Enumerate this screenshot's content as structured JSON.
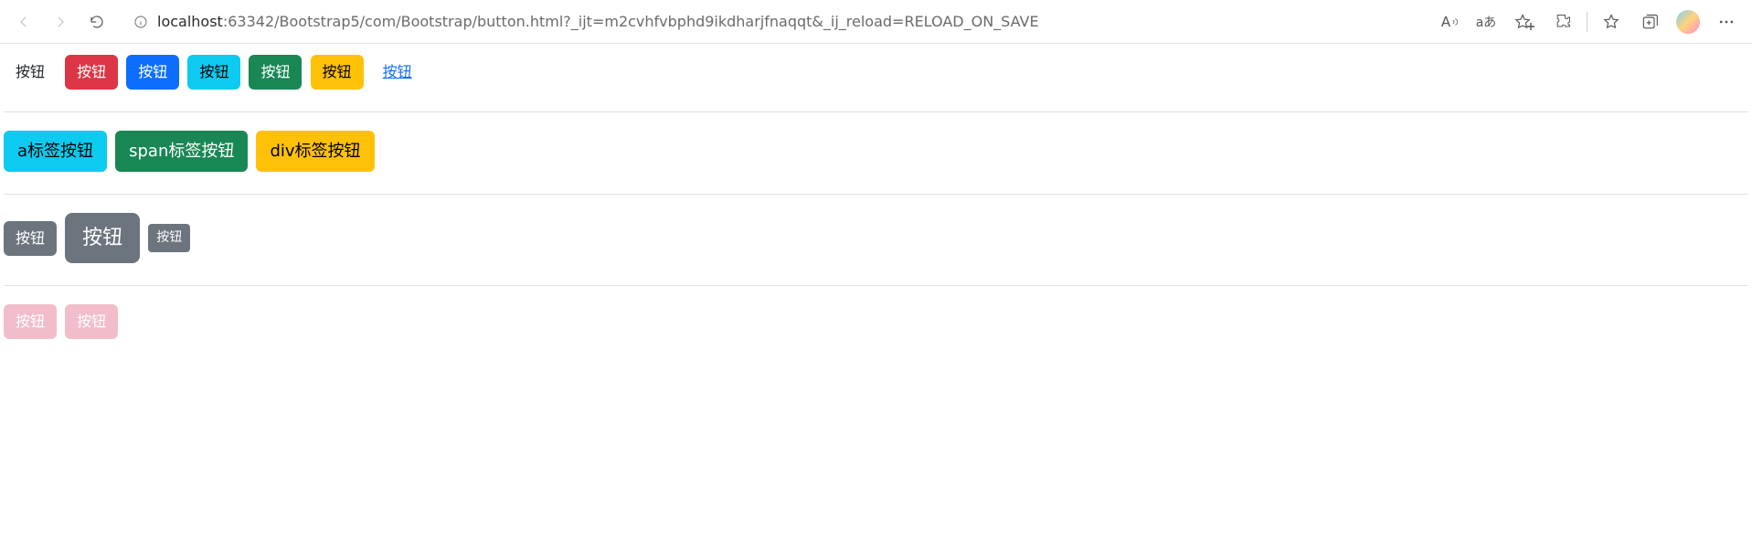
{
  "browser": {
    "url_host": "localhost",
    "url_rest": ":63342/Bootstrap5/com/Bootstrap/button.html?_ijt=m2cvhfvbphd9ikdharjfnaqqt&_ij_reload=RELOAD_ON_SAVE",
    "read_aloud": "A",
    "translate": "aあ"
  },
  "row1": {
    "btn_default": "按钮",
    "btn_danger": "按钮",
    "btn_primary": "按钮",
    "btn_info": "按钮",
    "btn_success": "按钮",
    "btn_warning": "按钮",
    "btn_link": "按钮"
  },
  "row2": {
    "a_tag": "a标签按钮",
    "span_tag": "span标签按钮",
    "div_tag": "div标签按钮"
  },
  "row3": {
    "normal": "按钮",
    "large": "按钮",
    "small": "按钮"
  },
  "row4": {
    "disabled1": "按钮",
    "disabled2": "按钮"
  }
}
